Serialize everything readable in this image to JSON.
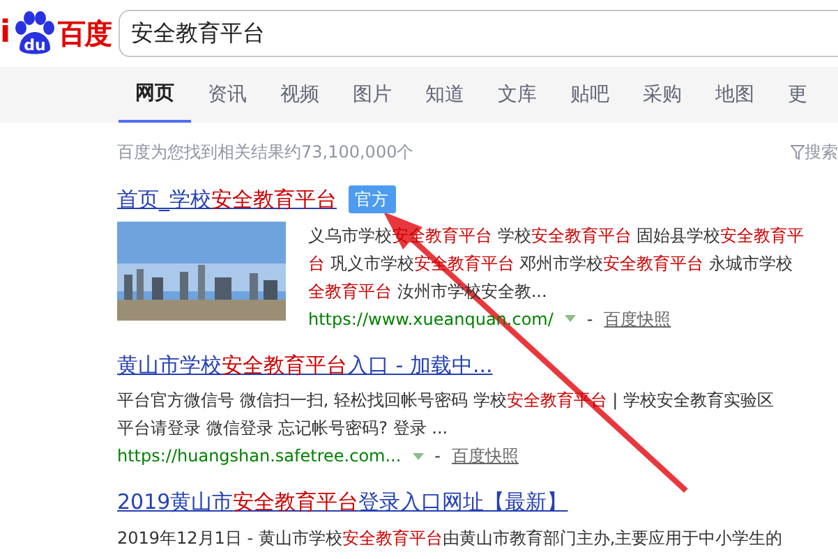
{
  "logo": {
    "prefix": "i",
    "paw_text": "du",
    "name": "百度"
  },
  "search": {
    "value": "安全教育平台"
  },
  "tabs": [
    {
      "label": "网页",
      "selected": true
    },
    {
      "label": "资讯",
      "selected": false
    },
    {
      "label": "视频",
      "selected": false
    },
    {
      "label": "图片",
      "selected": false
    },
    {
      "label": "知道",
      "selected": false
    },
    {
      "label": "文库",
      "selected": false
    },
    {
      "label": "贴吧",
      "selected": false
    },
    {
      "label": "采购",
      "selected": false
    },
    {
      "label": "地图",
      "selected": false
    },
    {
      "label": "更",
      "selected": false
    }
  ],
  "result_count": "百度为您找到相关结果约73,100,000个",
  "search_tools": "搜索",
  "results": [
    {
      "title": [
        {
          "t": "首页_学校",
          "hit": false
        },
        {
          "t": "安全教育平台",
          "hit": true
        }
      ],
      "badge": "官方",
      "kind": "picture",
      "lines": [
        [
          {
            "t": "义乌市学校",
            "hit": false
          },
          {
            "t": "安全教育平台",
            "hit": true
          },
          {
            "t": " 学校",
            "hit": false
          },
          {
            "t": "安全教育平台",
            "hit": true
          },
          {
            "t": " 固始县学校",
            "hit": false
          },
          {
            "t": "安全教育平",
            "hit": true
          }
        ],
        [
          {
            "t": "台",
            "hit": true
          },
          {
            "t": " 巩义市学校",
            "hit": false
          },
          {
            "t": "安全教育平台",
            "hit": true
          },
          {
            "t": " 邓州市学校",
            "hit": false
          },
          {
            "t": "安全教育平台",
            "hit": true
          },
          {
            "t": " 永城市学校",
            "hit": false
          }
        ],
        [
          {
            "t": "全教育平台",
            "hit": true
          },
          {
            "t": " 汝州市学校安全教...",
            "hit": false
          }
        ]
      ],
      "url": "https://www.xueanquan.com/",
      "separator": "-",
      "snapshot": "百度快照"
    },
    {
      "title": [
        {
          "t": "黄山市学校",
          "hit": false
        },
        {
          "t": "安全教育平台",
          "hit": true
        },
        {
          "t": "入口 - 加载中...",
          "hit": false
        }
      ],
      "lines": [
        [
          {
            "t": "平台官方微信号 微信扫一扫, 轻松找回帐号密码 学校",
            "hit": false
          },
          {
            "t": "安全教育平台",
            "hit": true
          },
          {
            "t": " | 学校安全教育实验区",
            "hit": false
          }
        ],
        [
          {
            "t": "平台请登录 微信登录 忘记帐号密码? 登录 ...",
            "hit": false
          }
        ]
      ],
      "url": "https://huangshan.safetree.com...",
      "separator": "-",
      "snapshot": "百度快照"
    },
    {
      "title": [
        {
          "t": "2019黄山市",
          "hit": false
        },
        {
          "t": "安全教育平台",
          "hit": true
        },
        {
          "t": "登录入口网址【最新】",
          "hit": false
        }
      ],
      "lines": [
        [
          {
            "t": "2019年12月1日 - 黄山市学校",
            "hit": false
          },
          {
            "t": "安全教育平台",
            "hit": true
          },
          {
            "t": "由黄山市教育部门主办,主要应用于中小学生的",
            "hit": false
          }
        ]
      ]
    }
  ]
}
